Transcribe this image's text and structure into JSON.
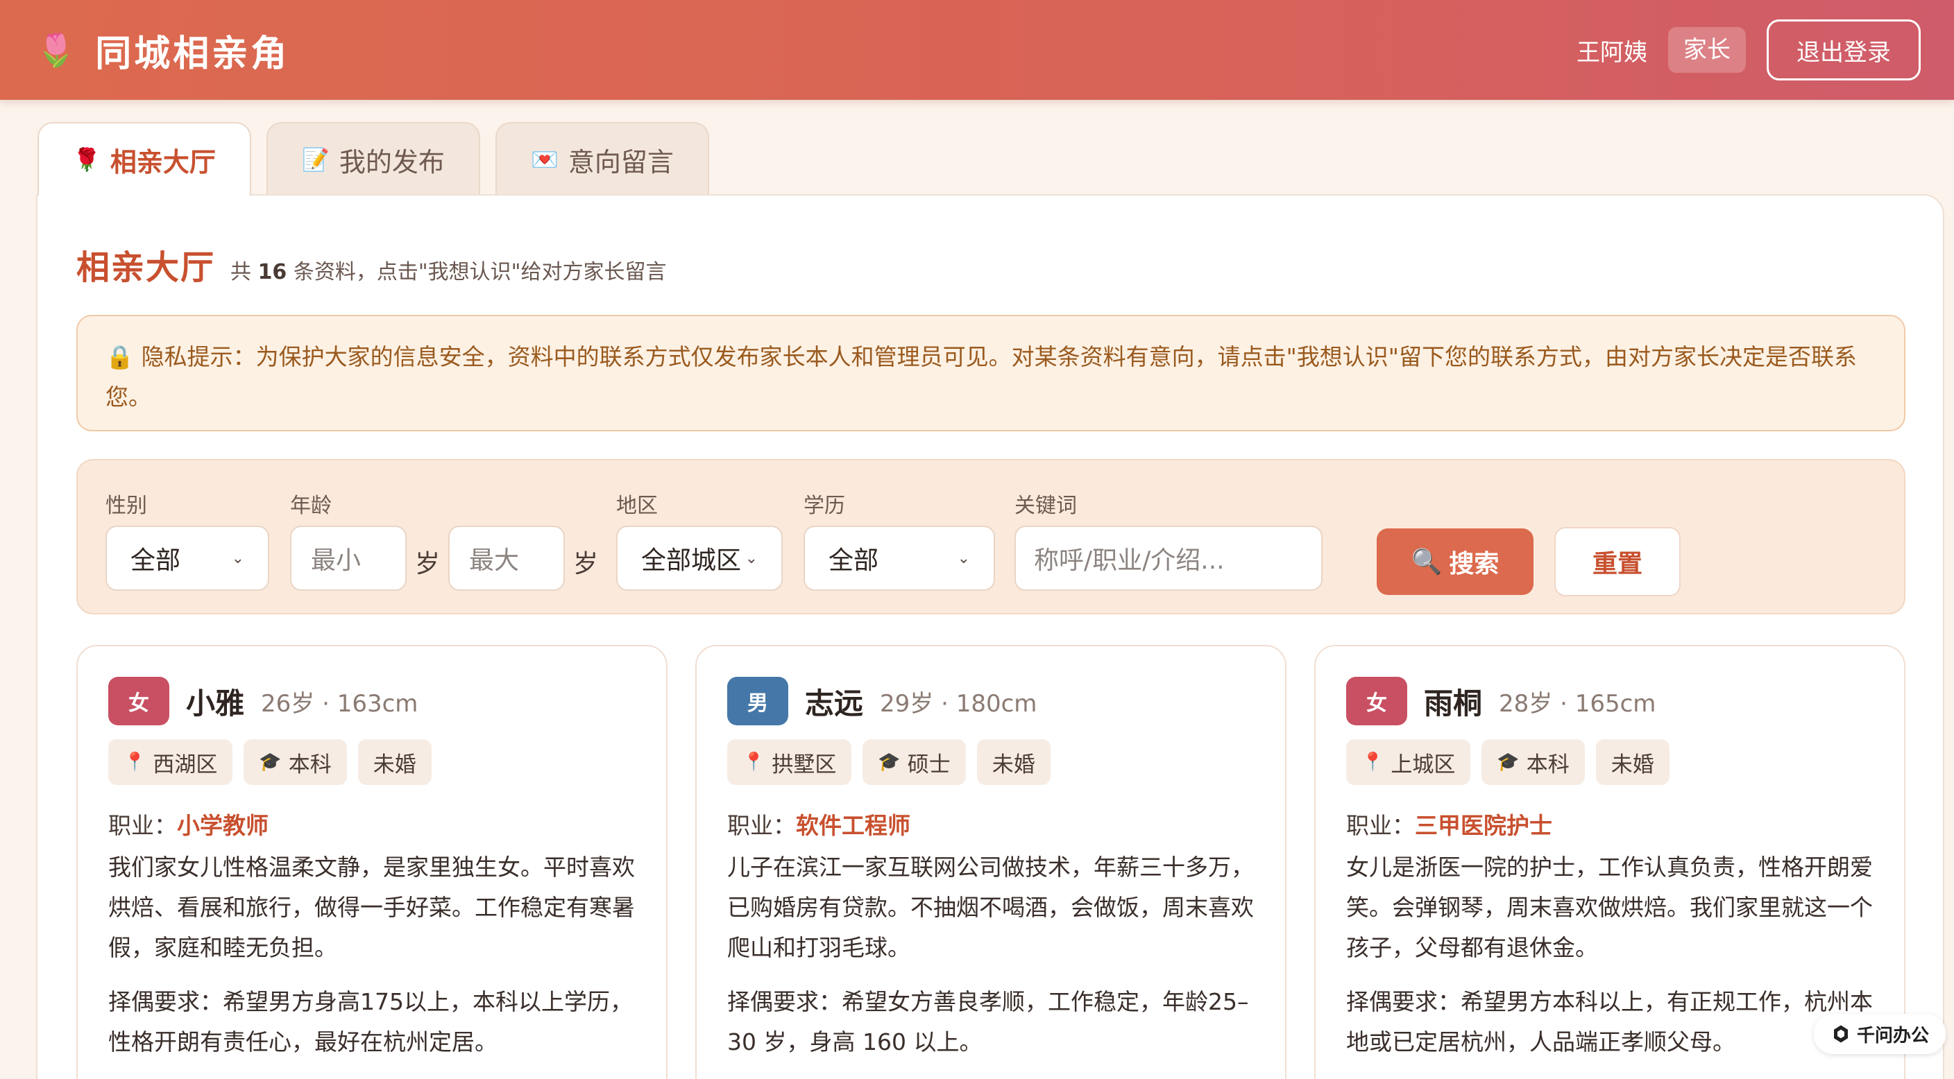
{
  "header": {
    "logo_icon": "🌷",
    "title": "同城相亲角",
    "user_name": "王阿姨",
    "role_badge": "家长",
    "logout_label": "退出登录"
  },
  "tabs": [
    {
      "icon": "🌹",
      "label": "相亲大厅",
      "active": true
    },
    {
      "icon": "📝",
      "label": "我的发布",
      "active": false
    },
    {
      "icon": "💌",
      "label": "意向留言",
      "active": false
    }
  ],
  "page": {
    "title": "相亲大厅",
    "subtitle_prefix": "共",
    "count": "16",
    "subtitle_suffix": "条资料，点击\"我想认识\"给对方家长留言"
  },
  "notice": {
    "icon": "🔒",
    "text": "隐私提示：为保护大家的信息安全，资料中的联系方式仅发布家长本人和管理员可见。对某条资料有意向，请点击\"我想认识\"留下您的联系方式，由对方家长决定是否联系您。"
  },
  "filters": {
    "gender": {
      "label": "性别",
      "value": "全部"
    },
    "age": {
      "label": "年龄",
      "min_placeholder": "最小",
      "max_placeholder": "最大",
      "unit": "岁"
    },
    "region": {
      "label": "地区",
      "value": "全部城区"
    },
    "education": {
      "label": "学历",
      "value": "全部"
    },
    "keyword": {
      "label": "关键词",
      "placeholder": "称呼/职业/介绍..."
    },
    "search_label": "搜索",
    "reset_label": "重置"
  },
  "cards": [
    {
      "gender": "女",
      "name": "小雅",
      "meta": "26岁 · 163cm",
      "tags": [
        {
          "icon": "📍",
          "text": "西湖区"
        },
        {
          "icon": "🎓",
          "text": "本科"
        },
        {
          "icon": "",
          "text": "未婚"
        }
      ],
      "job_label": "职业：",
      "job": "小学教师",
      "intro": "我们家女儿性格温柔文静，是家里独生女。平时喜欢烘焙、看展和旅行，做得一手好菜。工作稳定有寒暑假，家庭和睦无负担。",
      "requirement": "择偶要求：希望男方身高175以上，本科以上学历，性格开朗有责任心，最好在杭州定居。"
    },
    {
      "gender": "男",
      "name": "志远",
      "meta": "29岁 · 180cm",
      "tags": [
        {
          "icon": "📍",
          "text": "拱墅区"
        },
        {
          "icon": "🎓",
          "text": "硕士"
        },
        {
          "icon": "",
          "text": "未婚"
        }
      ],
      "job_label": "职业：",
      "job": "软件工程师",
      "intro": "儿子在滨江一家互联网公司做技术，年薪三十多万，已购婚房有贷款。不抽烟不喝酒，会做饭，周末喜欢爬山和打羽毛球。",
      "requirement": "择偶要求：希望女方善良孝顺，工作稳定，年龄25–30 岁，身高 160 以上。"
    },
    {
      "gender": "女",
      "name": "雨桐",
      "meta": "28岁 · 165cm",
      "tags": [
        {
          "icon": "📍",
          "text": "上城区"
        },
        {
          "icon": "🎓",
          "text": "本科"
        },
        {
          "icon": "",
          "text": "未婚"
        }
      ],
      "job_label": "职业：",
      "job": "三甲医院护士",
      "intro": "女儿是浙医一院的护士，工作认真负责，性格开朗爱笑。会弹钢琴，周末喜欢做烘焙。我们家里就这一个孩子，父母都有退休金。",
      "requirement": "择偶要求：希望男方本科以上，有正规工作，杭州本地或已定居杭州，人品端正孝顺父母。"
    }
  ],
  "watermark": {
    "text": "千问办公"
  },
  "colors": {
    "header_start": "#dc6a4e",
    "header_end": "#cf5c6a",
    "accent": "#c8502f",
    "female_badge": "#c85062",
    "male_badge": "#4578a8",
    "notice_bg": "#fdf1e4"
  }
}
